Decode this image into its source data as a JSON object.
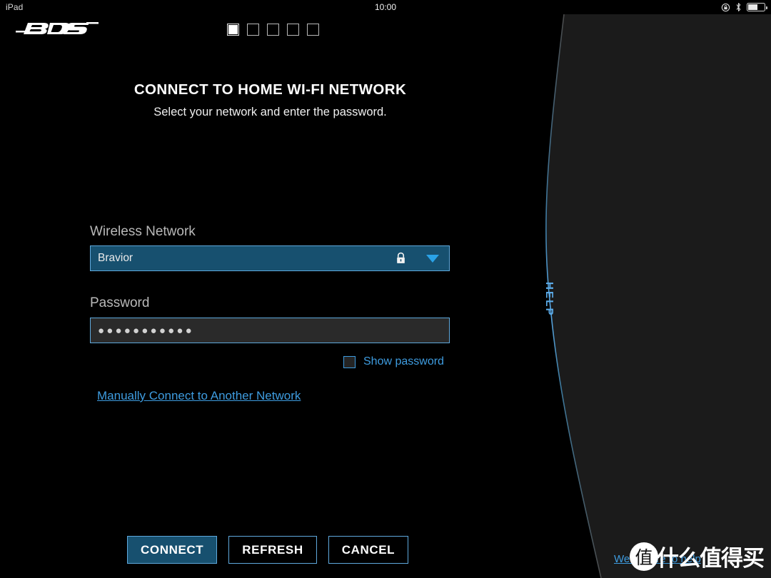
{
  "status_bar": {
    "device": "iPad",
    "clock": "10:00",
    "icons": [
      "rotation-lock-icon",
      "bluetooth-icon",
      "battery-icon"
    ]
  },
  "brand": {
    "logo": "bose-logo",
    "name": "BOSE"
  },
  "progress": {
    "total_steps": 5,
    "current_step": 1
  },
  "main": {
    "title": "CONNECT TO HOME WI-FI NETWORK",
    "subtitle": "Select your network and enter the password.",
    "network": {
      "label": "Wireless Network",
      "selected": "Bravior",
      "secured_icon": "lock-icon",
      "dropdown_icon": "chevron-down-icon"
    },
    "password": {
      "label": "Password",
      "masked_value": "●●●●●●●●●●●",
      "show_password_label": "Show password",
      "show_password_checked": false
    },
    "manual_link": "Manually Connect to Another Network"
  },
  "footer": {
    "connect_label": "CONNECT",
    "refresh_label": "REFRESH",
    "cancel_label": "CANCEL"
  },
  "help_panel": {
    "tab_label": "HELP",
    "bottom_link": "We're here to help"
  },
  "watermark": {
    "mark": "值",
    "text": "什么值得买"
  },
  "colors": {
    "background": "#000000",
    "accent_blue": "#3e9ce0",
    "field_fill": "#17506f",
    "panel": "#1c1c1c",
    "border_blue": "#5fa9dd"
  }
}
